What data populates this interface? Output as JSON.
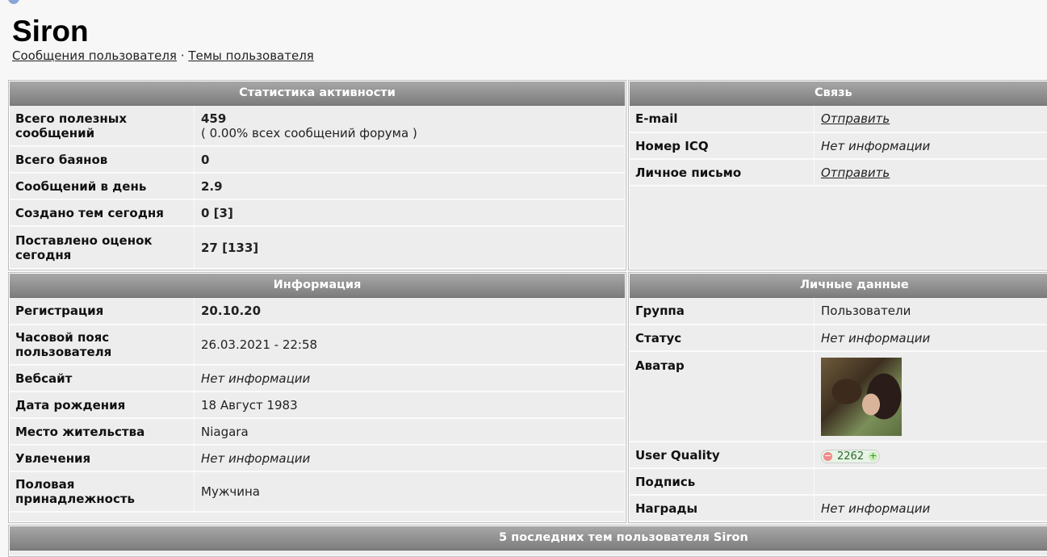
{
  "profile": {
    "username": "Siron",
    "links": [
      "Сообщения пользователя",
      "Темы пользователя"
    ],
    "separator": "·"
  },
  "activity": {
    "title": "Статистика активности",
    "rows": [
      {
        "label": "Всего полезных сообщений",
        "value": "459",
        "sub": "( 0.00% всех сообщений форума )"
      },
      {
        "label": "Всего баянов",
        "value": "0"
      },
      {
        "label": "Сообщений в день",
        "value": "2.9"
      },
      {
        "label": "Создано тем сегодня",
        "value": "0 [3]"
      },
      {
        "label": "Поставлено оценок сегодня",
        "value": "27 [133]"
      }
    ]
  },
  "contact": {
    "title": "Связь",
    "rows": [
      {
        "label": "E-mail",
        "value": "Отправить"
      },
      {
        "label": "Номер ICQ",
        "value": "Нет информации"
      },
      {
        "label": "Личное письмо",
        "value": "Отправить"
      }
    ]
  },
  "information": {
    "title": "Информация",
    "rows": [
      {
        "label": "Регистрация",
        "value": "20.10.20"
      },
      {
        "label": "Часовой пояс пользователя",
        "value": "26.03.2021 - 22:58"
      },
      {
        "label": "Вебсайт",
        "value": "Нет информации"
      },
      {
        "label": "Дата рождения",
        "value": "18 Август 1983"
      },
      {
        "label": "Место жительства",
        "value": "Niagara"
      },
      {
        "label": "Увлечения",
        "value": "Нет информации"
      },
      {
        "label": "Половая принадлежность",
        "value": "Мужчина"
      }
    ]
  },
  "personal": {
    "title": "Личные данные",
    "rows": [
      {
        "label": "Группа",
        "value": "Пользователи"
      },
      {
        "label": "Статус",
        "value": "Нет информации"
      },
      {
        "label": "Аватар",
        "value": ""
      },
      {
        "label": "User Quality",
        "value": "2262"
      },
      {
        "label": "Подпись",
        "value": ""
      },
      {
        "label": "Награды",
        "value": "Нет информации"
      }
    ],
    "rating_minus": "−",
    "rating_plus": "+"
  },
  "recent_topics": {
    "title": "5 последних тем пользователя Siron"
  }
}
